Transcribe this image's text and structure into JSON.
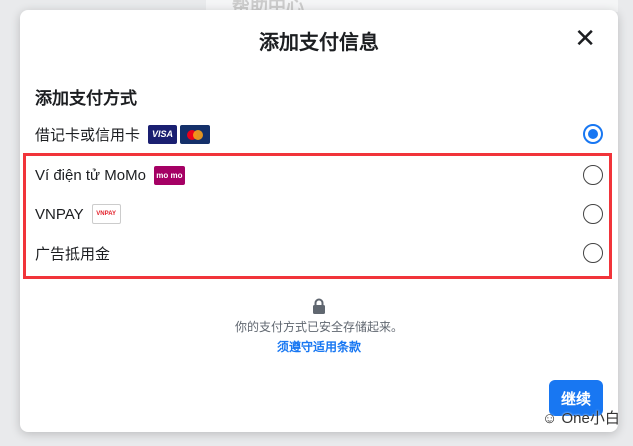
{
  "background": {
    "title": "帮助中心"
  },
  "modal": {
    "title": "添加支付信息",
    "close_icon": "close-icon",
    "section_title": "添加支付方式",
    "options": [
      {
        "label": "借记卡或信用卡",
        "selected": true,
        "badges": [
          "VISA",
          "mastercard"
        ]
      },
      {
        "label": "Ví điện tử MoMo",
        "selected": false,
        "badge_text": "mo mo"
      },
      {
        "label": "VNPAY",
        "selected": false,
        "badge_text": "VNPAY"
      },
      {
        "label": "广告抵用金",
        "selected": false
      }
    ],
    "secure_text": "你的支付方式已安全存储起来。",
    "terms_link": "须遵守适用条款",
    "continue_button": "继续"
  },
  "watermark": "One小白",
  "colors": {
    "accent": "#1877f2",
    "highlight": "#f1343a"
  }
}
